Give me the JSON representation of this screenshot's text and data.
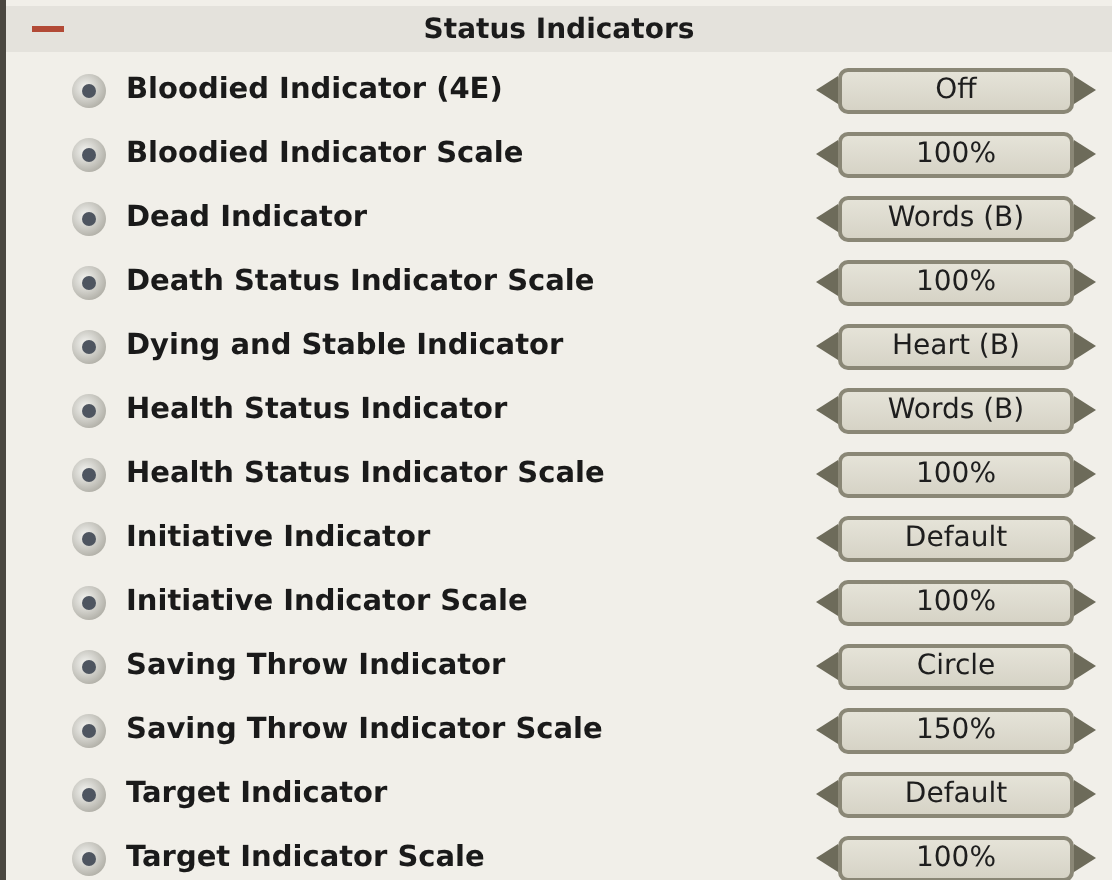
{
  "section": {
    "title": "Status Indicators",
    "expanded": true
  },
  "options": [
    {
      "label": "Bloodied Indicator (4E)",
      "value": "Off"
    },
    {
      "label": "Bloodied Indicator Scale",
      "value": "100%"
    },
    {
      "label": "Dead Indicator",
      "value": "Words (B)"
    },
    {
      "label": "Death Status Indicator Scale",
      "value": "100%"
    },
    {
      "label": "Dying and Stable Indicator",
      "value": "Heart (B)"
    },
    {
      "label": "Health Status Indicator",
      "value": "Words (B)"
    },
    {
      "label": "Health Status Indicator Scale",
      "value": "100%"
    },
    {
      "label": "Initiative Indicator",
      "value": "Default"
    },
    {
      "label": "Initiative Indicator Scale",
      "value": "100%"
    },
    {
      "label": "Saving Throw Indicator",
      "value": "Circle"
    },
    {
      "label": "Saving Throw Indicator Scale",
      "value": "150%"
    },
    {
      "label": "Target Indicator",
      "value": "Default"
    },
    {
      "label": "Target Indicator Scale",
      "value": "100%"
    }
  ]
}
